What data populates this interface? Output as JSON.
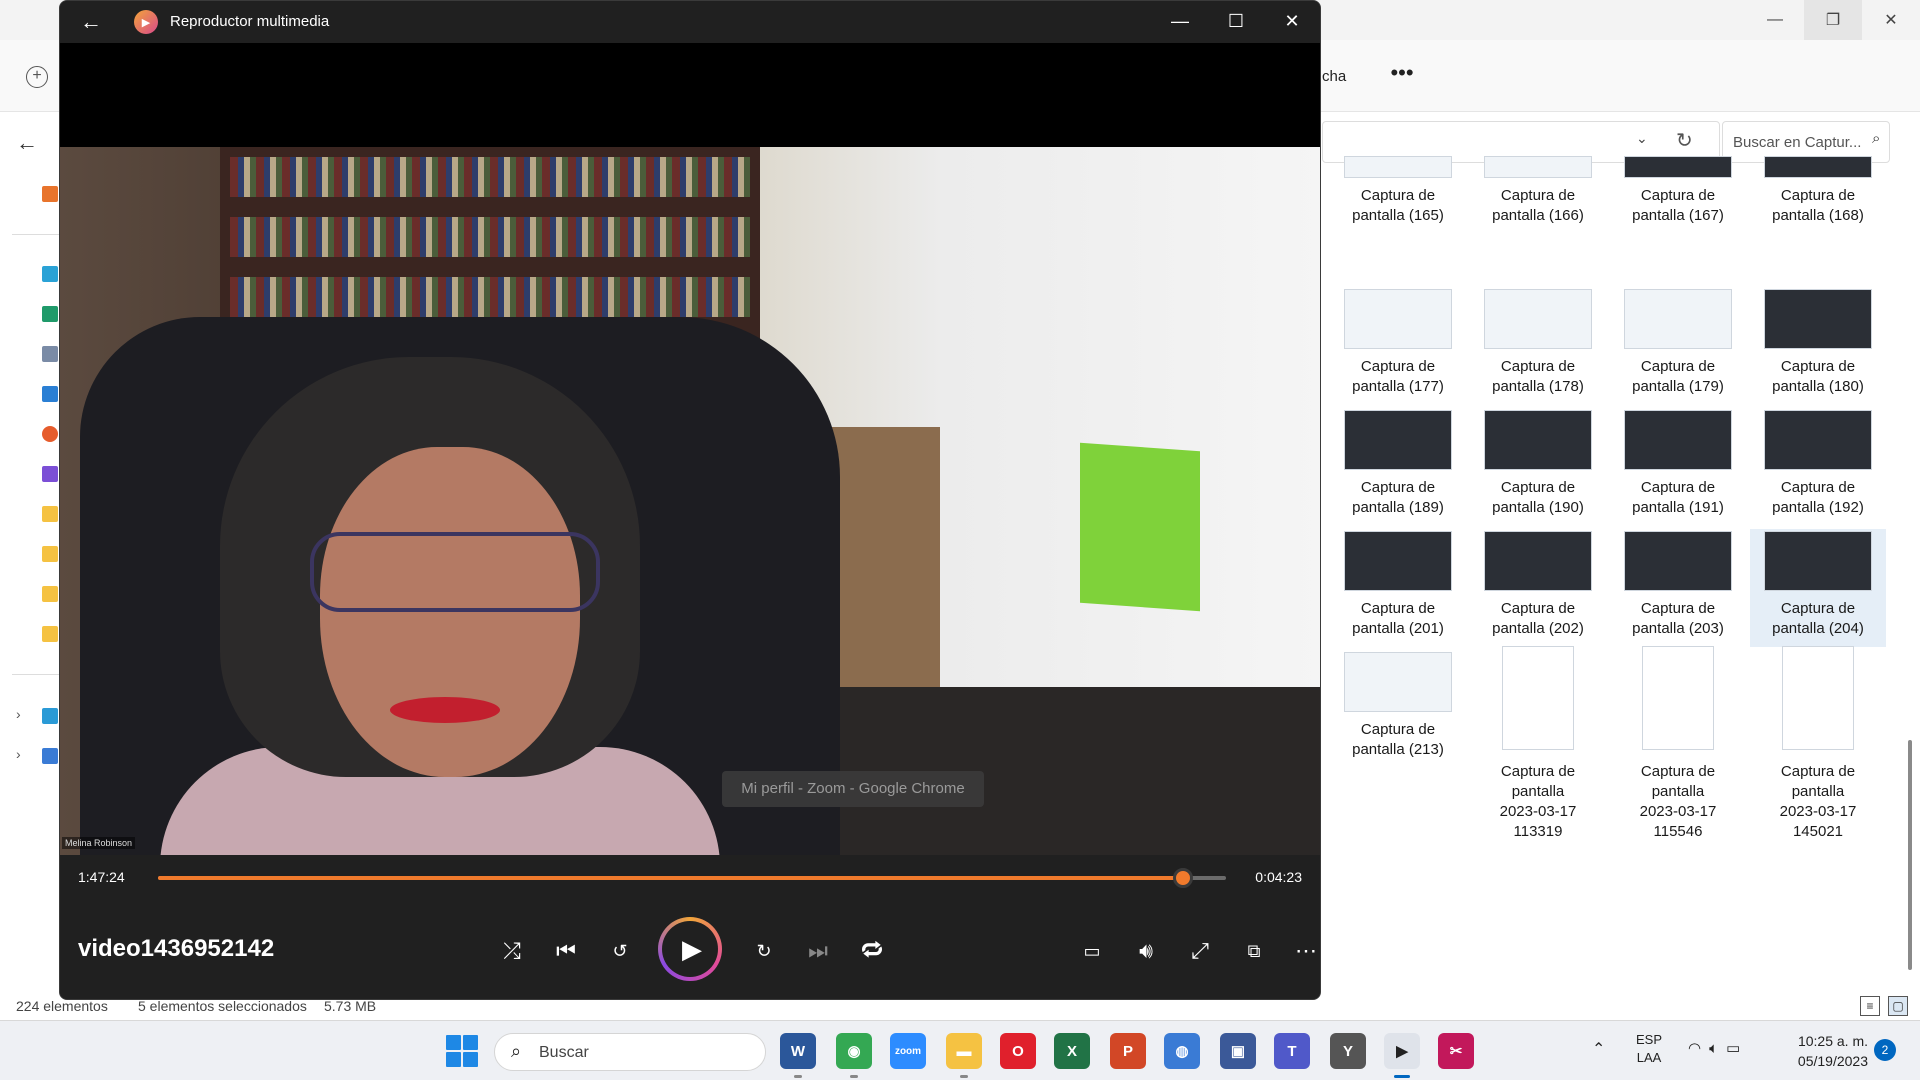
{
  "explorer": {
    "toolbar_partial_text": "cha",
    "more_label": "•••",
    "search_placeholder": "Buscar en Captur...",
    "status": {
      "count": "224 elementos",
      "selected": "5 elementos seleccionados",
      "size": "5.73 MB"
    },
    "tiles": [
      {
        "line1": "Captura de",
        "line2": "pantalla (165)",
        "line3": "",
        "thumb": "light"
      },
      {
        "line1": "Captura de",
        "line2": "pantalla (166)",
        "line3": "",
        "thumb": "light"
      },
      {
        "line1": "Captura de",
        "line2": "pantalla (167)",
        "line3": "",
        "thumb": "dark"
      },
      {
        "line1": "Captura de",
        "line2": "pantalla (168)",
        "line3": "",
        "thumb": "dark"
      },
      {
        "line1": "Captura de",
        "line2": "pantalla (177)",
        "line3": "",
        "thumb": "light"
      },
      {
        "line1": "Captura de",
        "line2": "pantalla (178)",
        "line3": "",
        "thumb": "light"
      },
      {
        "line1": "Captura de",
        "line2": "pantalla (179)",
        "line3": "",
        "thumb": "light"
      },
      {
        "line1": "Captura de",
        "line2": "pantalla (180)",
        "line3": "",
        "thumb": "dark"
      },
      {
        "line1": "Captura de",
        "line2": "pantalla (189)",
        "line3": "",
        "thumb": "dark"
      },
      {
        "line1": "Captura de",
        "line2": "pantalla (190)",
        "line3": "",
        "thumb": "dark"
      },
      {
        "line1": "Captura de",
        "line2": "pantalla (191)",
        "line3": "",
        "thumb": "dark"
      },
      {
        "line1": "Captura de",
        "line2": "pantalla (192)",
        "line3": "",
        "thumb": "dark"
      },
      {
        "line1": "Captura de",
        "line2": "pantalla (201)",
        "line3": "",
        "thumb": "dark"
      },
      {
        "line1": "Captura de",
        "line2": "pantalla (202)",
        "line3": "",
        "thumb": "dark"
      },
      {
        "line1": "Captura de",
        "line2": "pantalla (203)",
        "line3": "",
        "thumb": "dark"
      },
      {
        "line1": "Captura de",
        "line2": "pantalla (204)",
        "line3": "",
        "thumb": "dark",
        "selected": true
      },
      {
        "line1": "Captura de",
        "line2": "pantalla (213)",
        "line3": "",
        "thumb": "light"
      },
      {
        "line1": "Captura de",
        "line2": "pantalla",
        "line3": "2023-03-17",
        "line4": "113319",
        "thumb": "doc"
      },
      {
        "line1": "Captura de",
        "line2": "pantalla",
        "line3": "2023-03-17",
        "line4": "115546",
        "thumb": "doc"
      },
      {
        "line1": "Captura de",
        "line2": "pantalla",
        "line3": "2023-03-17",
        "line4": "145021",
        "thumb": "doc"
      }
    ]
  },
  "player": {
    "title": "Reproductor multimedia",
    "filename": "video1436952142",
    "elapsed": "1:47:24",
    "remaining": "0:04:23",
    "progress_fraction": 0.96,
    "tooltip": "Mi perfil - Zoom - Google Chrome",
    "participant_name": "Melina Robinson",
    "accent_color": "#f07a2c"
  },
  "taskbar": {
    "search_label": "Buscar",
    "lang_line1": "ESP",
    "lang_line2": "LAA",
    "time": "10:25 a. m.",
    "date": "05/19/2023",
    "notification_count": "2",
    "apps": [
      {
        "name": "word",
        "glyph": "W",
        "color": "#2b579a"
      },
      {
        "name": "chrome",
        "glyph": "◉",
        "color": "#34a853"
      },
      {
        "name": "zoom",
        "glyph": "zoom",
        "color": "#2d8cff"
      },
      {
        "name": "file-explorer",
        "glyph": "▬",
        "color": "#f5c242"
      },
      {
        "name": "opera",
        "glyph": "O",
        "color": "#e0202c"
      },
      {
        "name": "excel",
        "glyph": "X",
        "color": "#217346"
      },
      {
        "name": "powerpoint",
        "glyph": "P",
        "color": "#d24726"
      },
      {
        "name": "network-app",
        "glyph": "◍",
        "color": "#3a7bd5"
      },
      {
        "name": "remote-desktop",
        "glyph": "▣",
        "color": "#3b5998"
      },
      {
        "name": "teams",
        "glyph": "T",
        "color": "#5059c9"
      },
      {
        "name": "clock-app",
        "glyph": "Y",
        "color": "#555555"
      },
      {
        "name": "media-player",
        "glyph": "▶",
        "color": "#2a2a2a"
      },
      {
        "name": "snipping-tool",
        "glyph": "✂",
        "color": "#c2185b"
      }
    ]
  }
}
